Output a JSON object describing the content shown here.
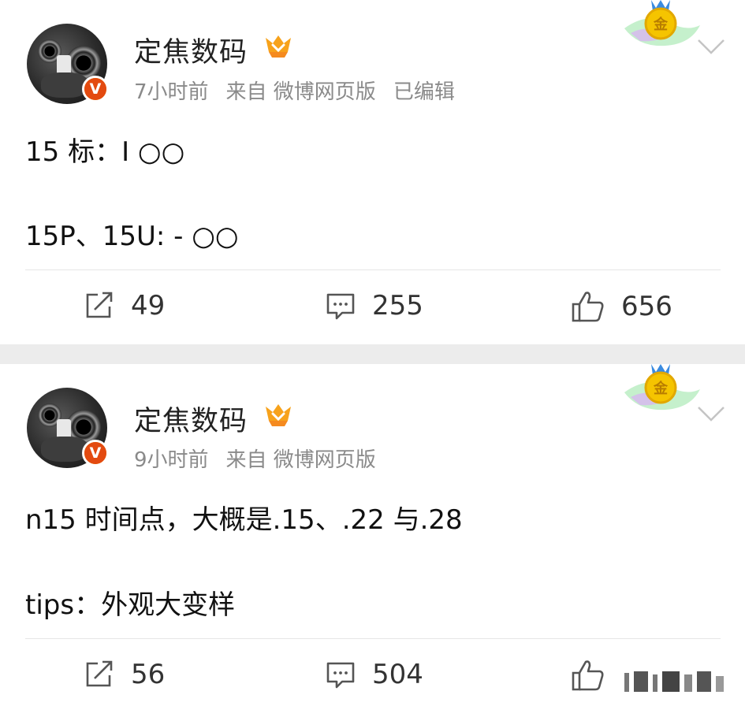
{
  "posts": [
    {
      "username": "定焦数码",
      "time": "7小时前",
      "source": "来自 微博网页版",
      "edited": "已编辑",
      "lines": [
        "15 标：I ○○",
        "15P、15U: - ○○"
      ],
      "actions": {
        "reposts": "49",
        "comments": "255",
        "likes": "656"
      },
      "medal_text": "金"
    },
    {
      "username": "定焦数码",
      "time": "9小时前",
      "source": "来自 微博网页版",
      "edited": "",
      "lines": [
        "n15 时间点，大概是.15、.22 与.28",
        "tips：外观大变样"
      ],
      "actions": {
        "reposts": "56",
        "comments": "504",
        "likes": ""
      },
      "medal_text": "金"
    }
  ],
  "avatar_badge": "V",
  "colors": {
    "badge_orange": "#e34a10",
    "medal_gold": "#f5c400",
    "meta_gray": "#8a8a8a"
  }
}
